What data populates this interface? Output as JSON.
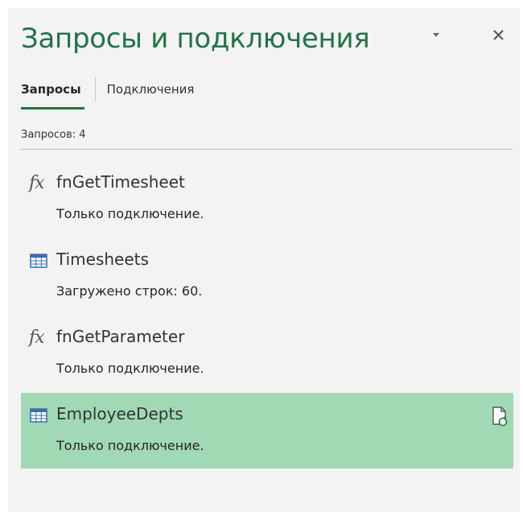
{
  "pane": {
    "title": "Запросы и подключения",
    "menu_icon": "caret-down-icon",
    "close_icon": "close-icon"
  },
  "tabs": [
    {
      "label": "Запросы",
      "active": true
    },
    {
      "label": "Подключения",
      "active": false
    }
  ],
  "query_count": "Запросов: 4",
  "queries": [
    {
      "name": "fnGetTimesheet",
      "status": "Только подключение.",
      "icon": "function-icon",
      "selected": false
    },
    {
      "name": "Timesheets",
      "status": "Загружено строк: 60.",
      "icon": "table-icon",
      "selected": false
    },
    {
      "name": "fnGetParameter",
      "status": "Только подключение.",
      "icon": "function-icon",
      "selected": false
    },
    {
      "name": "EmployeeDepts",
      "status": "Только подключение.",
      "icon": "table-icon",
      "selected": true,
      "action_icon": "refresh-document-icon"
    }
  ],
  "colors": {
    "accent": "#217346",
    "pane_background": "#f3f3f3",
    "selection": "#a0d9b4"
  }
}
